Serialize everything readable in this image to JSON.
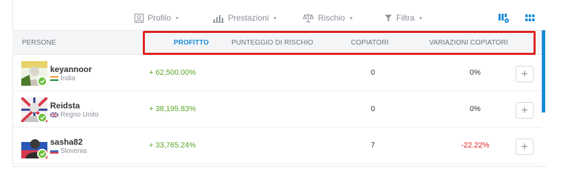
{
  "toolbar": {
    "profile_label": "Profilo",
    "performance_label": "Prestazioni",
    "risk_label": "Rischio",
    "filter_label": "Filtra",
    "caret": "▾"
  },
  "columns": {
    "people": "PERSONE",
    "profit": "PROFITTO",
    "risk_score": "PUNTEGGIO DI RISCHIO",
    "copiers": "COPIATORI",
    "copier_changes": "VARIAZIONI COPIATORI"
  },
  "rows": [
    {
      "username": "keyannoor",
      "country": "India",
      "profit": "+ 62,500.00%",
      "copiers": "0",
      "change": "0%",
      "change_negative": false
    },
    {
      "username": "Reidsta",
      "country": "Regno Unito",
      "profit": "+ 38,195.83%",
      "copiers": "0",
      "change": "0%",
      "change_negative": false
    },
    {
      "username": "sasha82",
      "country": "Slovenia",
      "profit": "+ 33,765.24%",
      "copiers": "7",
      "change": "-22.22%",
      "change_negative": true
    }
  ],
  "add_button_label": "+",
  "colors": {
    "accent": "#1a8ad8",
    "positive": "#59a323",
    "negative": "#e0201c",
    "highlight_box": "#e0201c",
    "verified": "#6bbf3b"
  },
  "icons": {
    "profile": "profile-icon",
    "performance": "bar-chart-icon",
    "risk": "scales-icon",
    "filter": "filter-icon",
    "list_view": "list-view-icon",
    "grid_view": "grid-view-icon",
    "verified": "checkmark-icon"
  }
}
